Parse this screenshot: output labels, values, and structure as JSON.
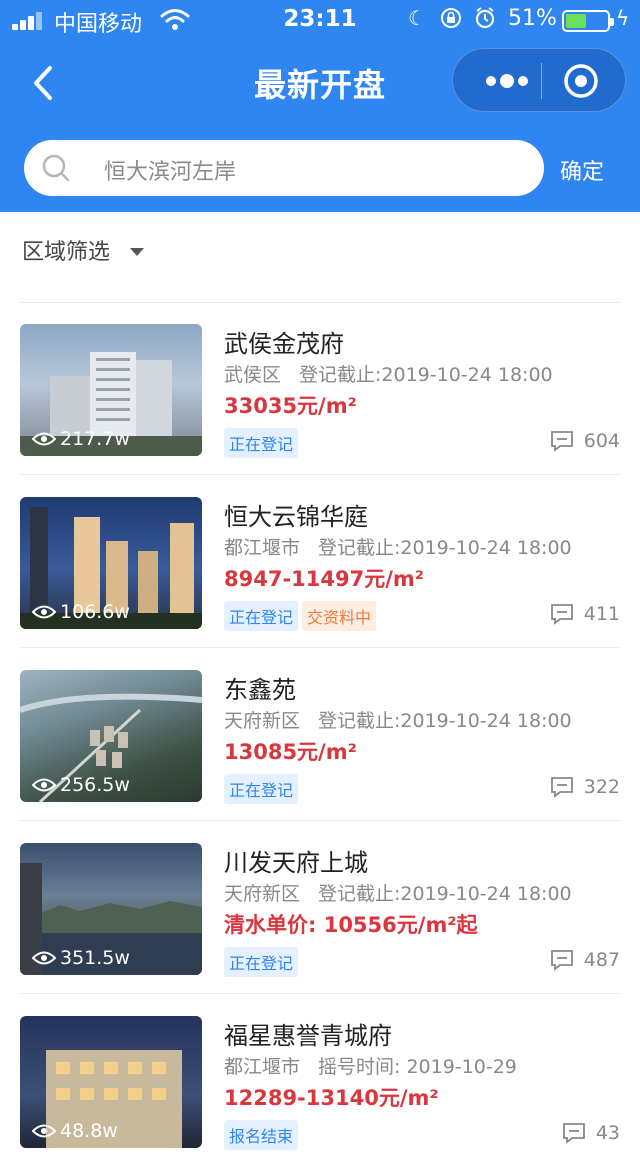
{
  "status_bar": {
    "carrier": "中国移动",
    "time": "23:11",
    "battery_percent": "51%",
    "battery_level": 0.51
  },
  "navbar": {
    "title": "最新开盘"
  },
  "search": {
    "value": "恒大滨河左岸",
    "confirm_label": "确定"
  },
  "filter": {
    "label": "区域筛选"
  },
  "colors": {
    "brand_blue": "#2f86f0",
    "price_red": "#d9363e",
    "tag_orange": "#ee7a3a"
  },
  "listings": [
    {
      "name": "武侯金茂府",
      "district": "武侯区",
      "deadline": "登记截止:2019-10-24 18:00",
      "price": "33035元/m²",
      "views": "217.7w",
      "tags": [
        "正在登记"
      ],
      "comments": "604"
    },
    {
      "name": "恒大云锦华庭",
      "district": "都江堰市",
      "deadline": "登记截止:2019-10-24 18:00",
      "price": "8947-11497元/m²",
      "views": "106.6w",
      "tags": [
        "正在登记",
        "交资料中"
      ],
      "comments": "411"
    },
    {
      "name": "东鑫苑",
      "district": "天府新区",
      "deadline": "登记截止:2019-10-24 18:00",
      "price": "13085元/m²",
      "views": "256.5w",
      "tags": [
        "正在登记"
      ],
      "comments": "322"
    },
    {
      "name": "川发天府上城",
      "district": "天府新区",
      "deadline": "登记截止:2019-10-24 18:00",
      "price": "清水单价: 10556元/m²起",
      "views": "351.5w",
      "tags": [
        "正在登记"
      ],
      "comments": "487"
    },
    {
      "name": "福星惠誉青城府",
      "district": "都江堰市",
      "deadline": "摇号时间: 2019-10-29",
      "price": "12289-13140元/m²",
      "views": "48.8w",
      "tags": [
        "报名结束"
      ],
      "comments": "43"
    }
  ]
}
